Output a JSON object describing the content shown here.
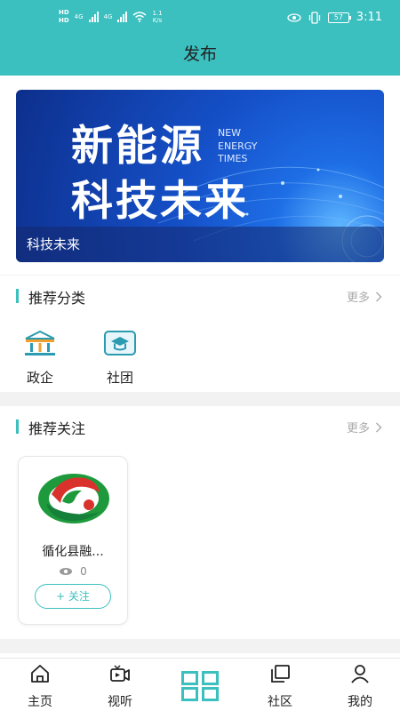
{
  "status_bar": {
    "hd1": "HD",
    "hd2": "HD",
    "net_type1": "4G",
    "net_type2": "4G",
    "net_speed_value": "1.1",
    "net_speed_unit": "K/s",
    "battery": "57",
    "time": "3:11"
  },
  "title": "发布",
  "banner": {
    "line1": "新能源",
    "line2": "科技未来",
    "en_line1": "NEW",
    "en_line2": "ENERGY",
    "en_line3": "TIMES",
    "caption": "科技未来"
  },
  "recommend_categories": {
    "title": "推荐分类",
    "more": "更多",
    "items": [
      {
        "label": "政企",
        "icon": "government-building-icon"
      },
      {
        "label": "社团",
        "icon": "graduation-cap-icon"
      }
    ]
  },
  "recommend_follow": {
    "title": "推荐关注",
    "more": "更多",
    "cards": [
      {
        "name": "循化县融...",
        "views": "0",
        "follow_label": "+ 关注"
      }
    ]
  },
  "tabbar": {
    "items": [
      {
        "label": "主页",
        "icon": "home-icon"
      },
      {
        "label": "视听",
        "icon": "video-icon"
      },
      {
        "label": "",
        "icon": "publish-grid-icon"
      },
      {
        "label": "社区",
        "icon": "community-icon"
      },
      {
        "label": "我的",
        "icon": "user-icon"
      }
    ]
  },
  "colors": {
    "accent": "#3bbfbf",
    "logo_green": "#1e9a3c",
    "logo_red": "#d9322c"
  }
}
